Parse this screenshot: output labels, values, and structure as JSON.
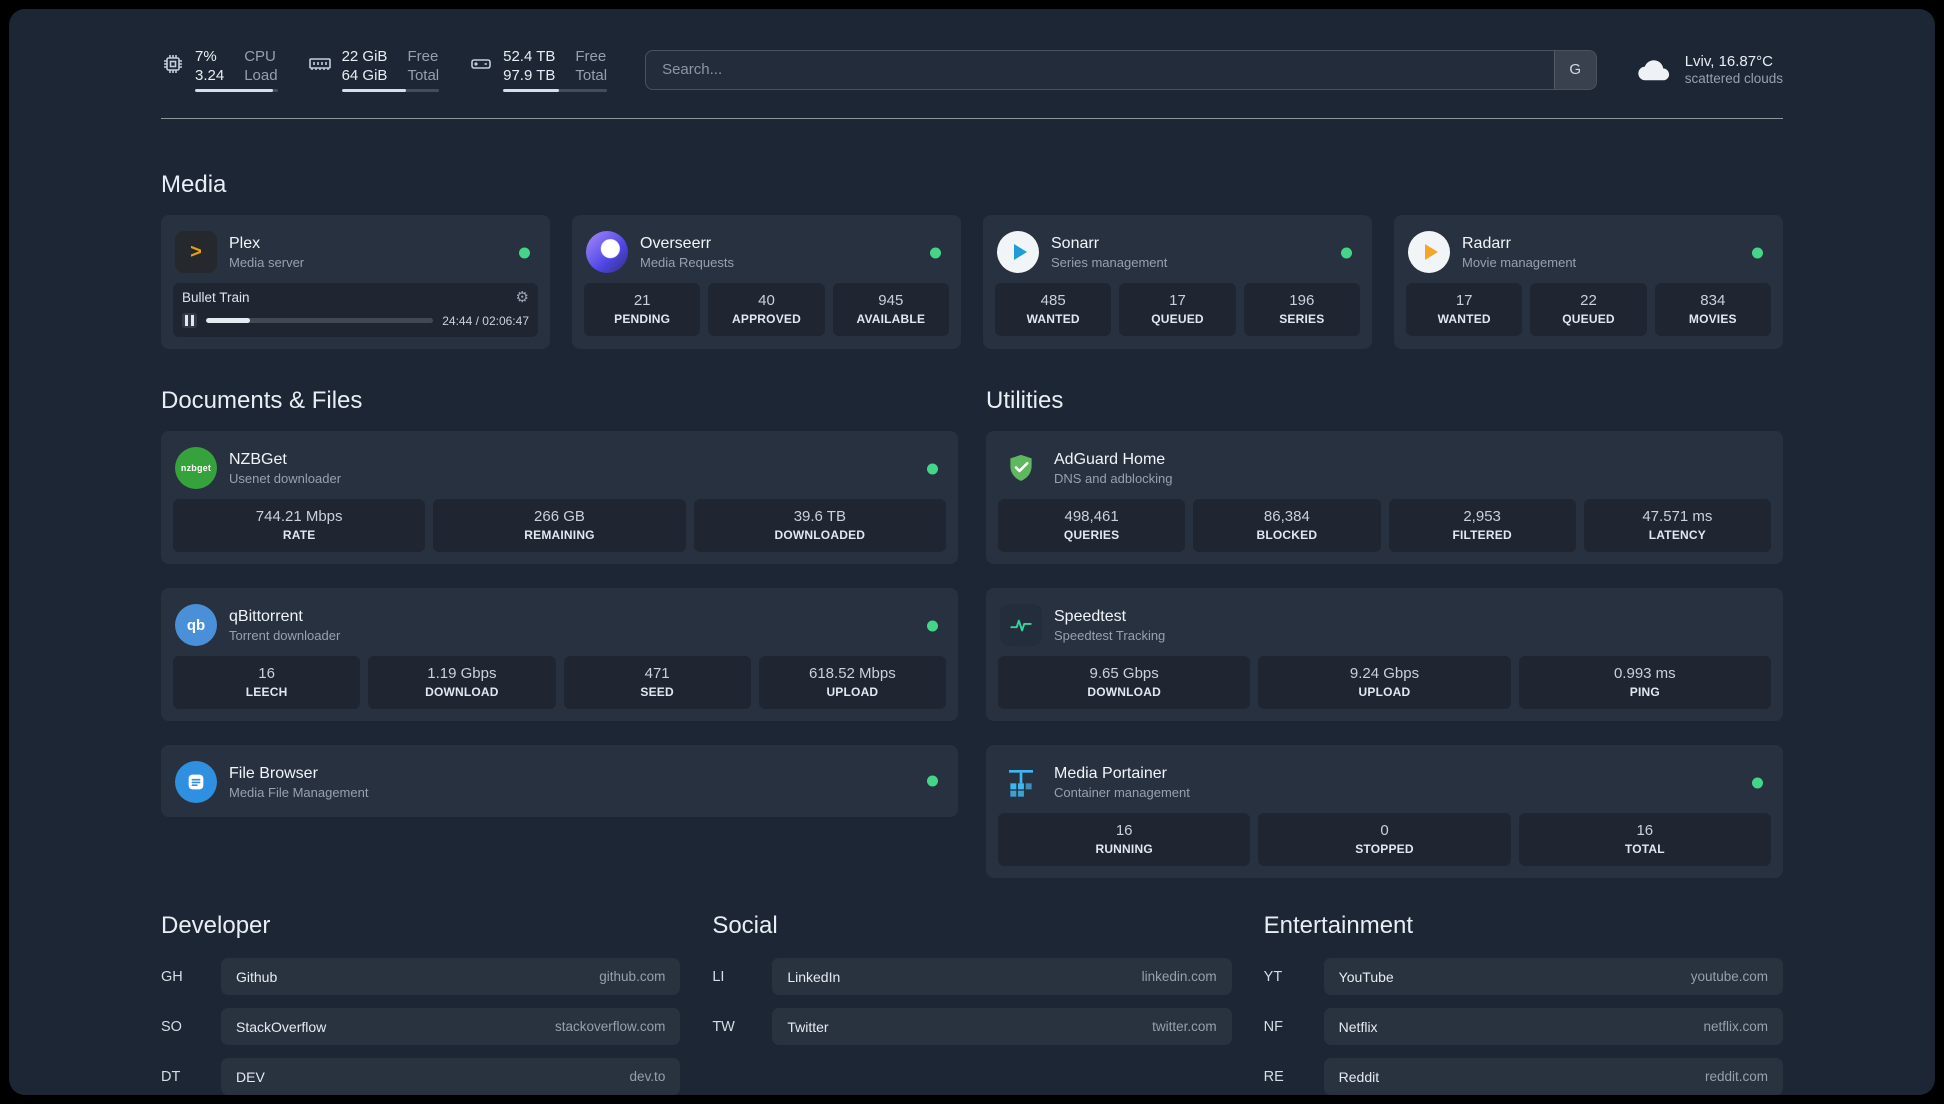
{
  "topbar": {
    "cpu": {
      "value": "7%",
      "sub": "3.24",
      "label1": "CPU",
      "label2": "Load",
      "bar_percent": 95
    },
    "memory": {
      "value": "22 GiB",
      "sub": "64 GiB",
      "label1": "Free",
      "label2": "Total",
      "bar_percent": 66
    },
    "disk": {
      "value": "52.4 TB",
      "sub": "97.9 TB",
      "label1": "Free",
      "label2": "Total",
      "bar_percent": 54
    },
    "search": {
      "placeholder": "Search...",
      "button": "G"
    },
    "weather": {
      "location": "Lviv, 16.87°C",
      "condition": "scattered clouds"
    }
  },
  "sections": {
    "media": {
      "title": "Media",
      "cards": [
        {
          "name": "Plex",
          "description": "Media server",
          "icon": "plex-icon",
          "player": {
            "title": "Bullet Train",
            "time": "24:44 / 02:06:47",
            "progress_percent": 19.5
          }
        },
        {
          "name": "Overseerr",
          "description": "Media Requests",
          "icon": "overseerr-icon",
          "stats": [
            {
              "value": "21",
              "label": "PENDING"
            },
            {
              "value": "40",
              "label": "APPROVED"
            },
            {
              "value": "945",
              "label": "AVAILABLE"
            }
          ]
        },
        {
          "name": "Sonarr",
          "description": "Series management",
          "icon": "sonarr-icon",
          "stats": [
            {
              "value": "485",
              "label": "WANTED"
            },
            {
              "value": "17",
              "label": "QUEUED"
            },
            {
              "value": "196",
              "label": "SERIES"
            }
          ]
        },
        {
          "name": "Radarr",
          "description": "Movie management",
          "icon": "radarr-icon",
          "stats": [
            {
              "value": "17",
              "label": "WANTED"
            },
            {
              "value": "22",
              "label": "QUEUED"
            },
            {
              "value": "834",
              "label": "MOVIES"
            }
          ]
        }
      ]
    },
    "documents": {
      "title": "Documents & Files",
      "cards": [
        {
          "name": "NZBGet",
          "description": "Usenet downloader",
          "icon": "nzbget-icon",
          "stats": [
            {
              "value": "744.21 Mbps",
              "label": "RATE"
            },
            {
              "value": "266 GB",
              "label": "REMAINING"
            },
            {
              "value": "39.6 TB",
              "label": "DOWNLOADED"
            }
          ]
        },
        {
          "name": "qBittorrent",
          "description": "Torrent downloader",
          "icon": "qbittorrent-icon",
          "stats": [
            {
              "value": "16",
              "label": "LEECH"
            },
            {
              "value": "1.19 Gbps",
              "label": "DOWNLOAD"
            },
            {
              "value": "471",
              "label": "SEED"
            },
            {
              "value": "618.52 Mbps",
              "label": "UPLOAD"
            }
          ]
        },
        {
          "name": "File Browser",
          "description": "Media File Management",
          "icon": "filebrowser-icon",
          "stats": []
        }
      ]
    },
    "utilities": {
      "title": "Utilities",
      "cards": [
        {
          "name": "AdGuard Home",
          "description": "DNS and adblocking",
          "icon": "adguard-icon",
          "stats": [
            {
              "value": "498,461",
              "label": "QUERIES"
            },
            {
              "value": "86,384",
              "label": "BLOCKED"
            },
            {
              "value": "2,953",
              "label": "FILTERED"
            },
            {
              "value": "47.571 ms",
              "label": "LATENCY"
            }
          ]
        },
        {
          "name": "Speedtest",
          "description": "Speedtest Tracking",
          "icon": "speedtest-icon",
          "stats": [
            {
              "value": "9.65 Gbps",
              "label": "DOWNLOAD"
            },
            {
              "value": "9.24 Gbps",
              "label": "UPLOAD"
            },
            {
              "value": "0.993 ms",
              "label": "PING"
            }
          ]
        },
        {
          "name": "Media Portainer",
          "description": "Container management",
          "icon": "portainer-icon",
          "stats": [
            {
              "value": "16",
              "label": "RUNNING"
            },
            {
              "value": "0",
              "label": "STOPPED"
            },
            {
              "value": "16",
              "label": "TOTAL"
            }
          ]
        }
      ]
    }
  },
  "bookmarks": [
    {
      "title": "Developer",
      "items": [
        {
          "abbr": "GH",
          "name": "Github",
          "url": "github.com"
        },
        {
          "abbr": "SO",
          "name": "StackOverflow",
          "url": "stackoverflow.com"
        },
        {
          "abbr": "DT",
          "name": "DEV",
          "url": "dev.to"
        }
      ]
    },
    {
      "title": "Social",
      "items": [
        {
          "abbr": "LI",
          "name": "LinkedIn",
          "url": "linkedin.com"
        },
        {
          "abbr": "TW",
          "name": "Twitter",
          "url": "twitter.com"
        }
      ]
    },
    {
      "title": "Entertainment",
      "items": [
        {
          "abbr": "YT",
          "name": "YouTube",
          "url": "youtube.com"
        },
        {
          "abbr": "NF",
          "name": "Netflix",
          "url": "netflix.com"
        },
        {
          "abbr": "RE",
          "name": "Reddit",
          "url": "reddit.com"
        }
      ]
    }
  ],
  "icons": {
    "plex_glyph": ">",
    "nzbget_text": "nzbget",
    "qbittorrent_text": "qb"
  },
  "colors": {
    "status_online": "#44d58a",
    "background": "#1c2634",
    "plex_gold": "#e5a00d",
    "sonarr_blue": "#1e9cd7",
    "radarr_orange": "#f4a62a",
    "nzbget_green": "#36a23c",
    "adguard_green": "#5fb760",
    "portainer_blue": "#3db6f2",
    "speedtest_pulse": "#34d399"
  }
}
